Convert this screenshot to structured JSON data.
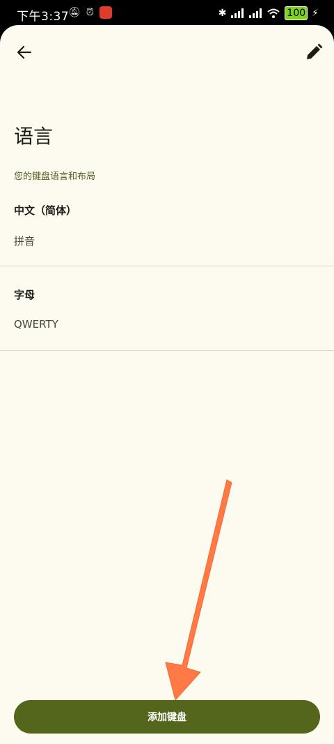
{
  "status": {
    "time": "下午3:37",
    "battery": "100"
  },
  "header": {
    "title": "语言"
  },
  "section": {
    "label": "您的键盘语言和布局"
  },
  "keyboards": [
    {
      "language": "中文（简体）",
      "layout": "拼音"
    },
    {
      "language": "字母",
      "layout": "QWERTY"
    }
  ],
  "footer": {
    "add_label": "添加键盘"
  },
  "colors": {
    "background": "#fdfaf0",
    "accent": "#53661c",
    "annotation_arrow": "#ff7a45"
  },
  "icons": {
    "back": "arrow-left-icon",
    "edit": "pencil-icon"
  }
}
